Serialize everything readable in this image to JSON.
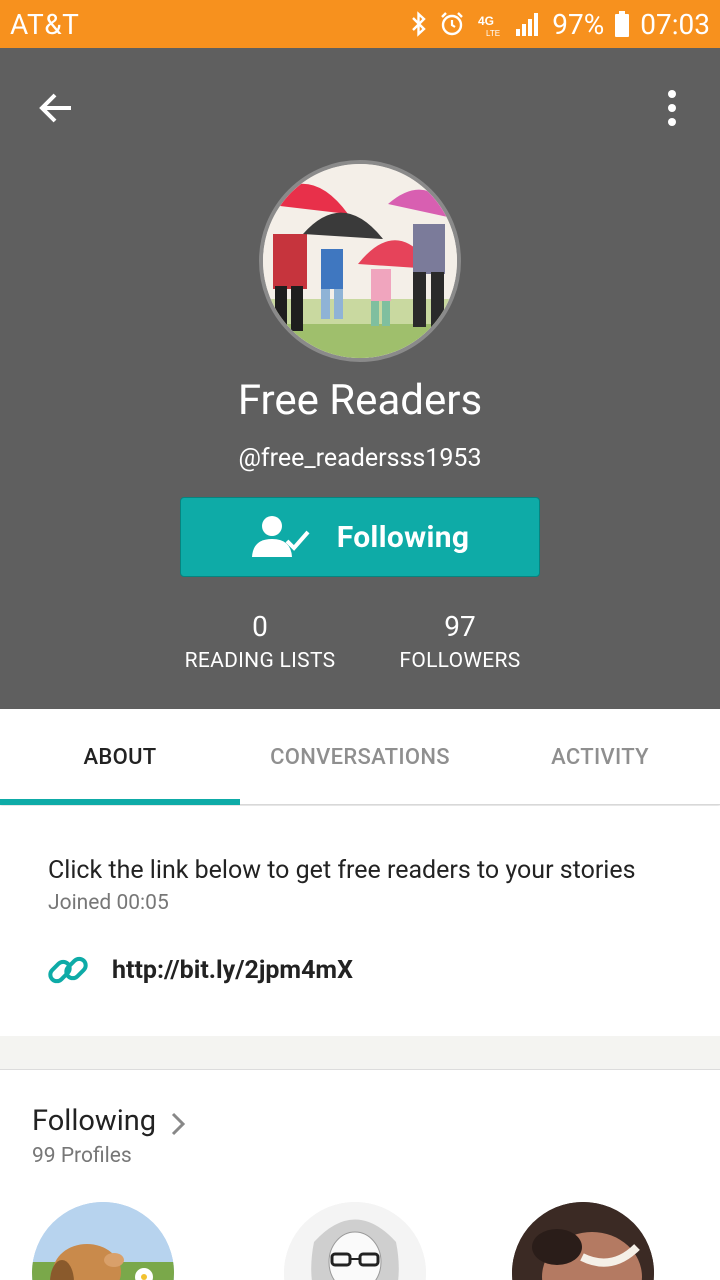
{
  "status_bar": {
    "carrier": "AT&T",
    "network": "4G",
    "battery_percent": "97%",
    "time": "07:03",
    "icons": [
      "bluetooth-icon",
      "alarm-icon",
      "lte-icon",
      "signal-icon",
      "battery-icon"
    ]
  },
  "profile": {
    "name": "Free Readers",
    "handle": "@free_readersss1953",
    "follow_button_label": "Following",
    "stats": [
      {
        "value": "0",
        "label": "READING LISTS"
      },
      {
        "value": "97",
        "label": "FOLLOWERS"
      }
    ]
  },
  "tabs": [
    {
      "label": "ABOUT",
      "active": true
    },
    {
      "label": "CONVERSATIONS",
      "active": false
    },
    {
      "label": "ACTIVITY",
      "active": false
    }
  ],
  "about": {
    "description": "Click the link below to get free readers to your stories",
    "joined": "Joined 00:05",
    "link": "http://bit.ly/2jpm4mX"
  },
  "following": {
    "title": "Following",
    "count": "99 Profiles"
  },
  "colors": {
    "status_bar": "#f7911e",
    "header_bg": "#5f5f5f",
    "accent": "#0eaba7"
  }
}
